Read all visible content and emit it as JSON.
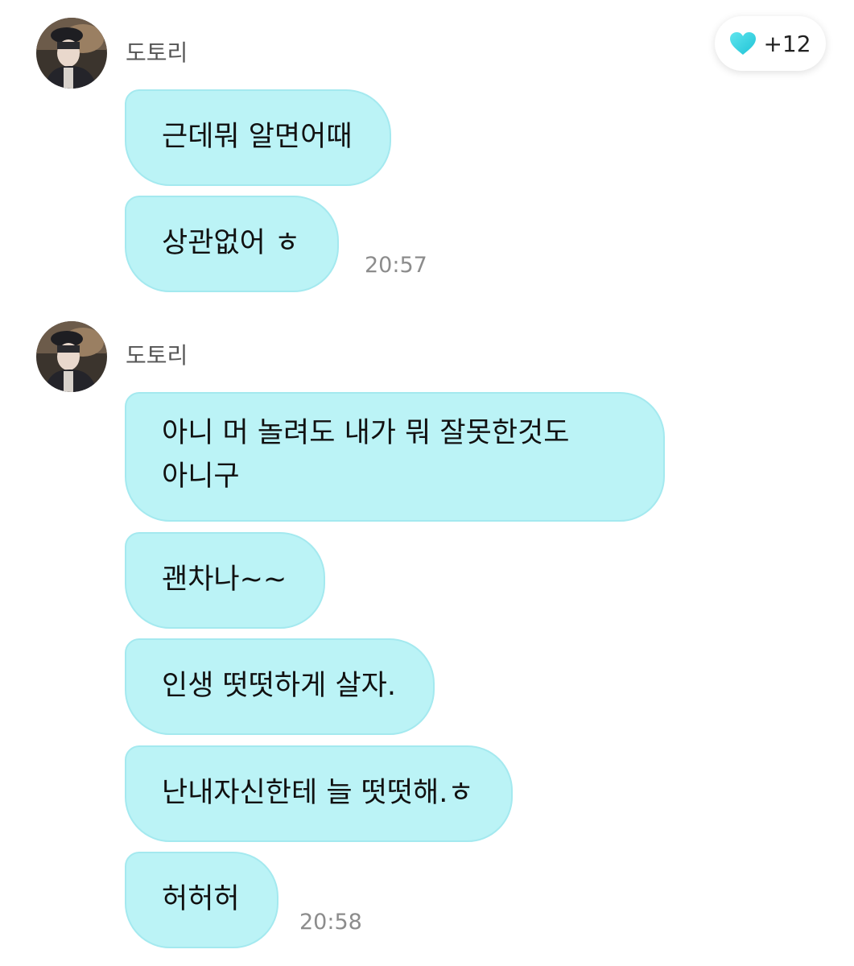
{
  "like_badge": {
    "count": "+12",
    "icon": "heart-icon",
    "color": "#35d6e3"
  },
  "theme": {
    "bubble_color": "#bbf3f6",
    "bubble_border": "#a4e9ef"
  },
  "groups": [
    {
      "sender": "도토리",
      "avatar_icon": "profile-photo",
      "messages": [
        {
          "text": "근데뭐 알면어때"
        },
        {
          "text": "상관없어 ㅎ",
          "time": "20:57"
        }
      ]
    },
    {
      "sender": "도토리",
      "avatar_icon": "profile-photo",
      "messages": [
        {
          "lines": [
            "아니 머 놀려도 내가 뭐 잘못한것도",
            "아니구"
          ]
        },
        {
          "text": "괜차나~~"
        },
        {
          "text": "인생 떳떳하게 살자."
        },
        {
          "text": "난내자신한테 늘 떳떳해.ㅎ"
        },
        {
          "text": "허허허",
          "time": "20:58"
        }
      ]
    }
  ]
}
